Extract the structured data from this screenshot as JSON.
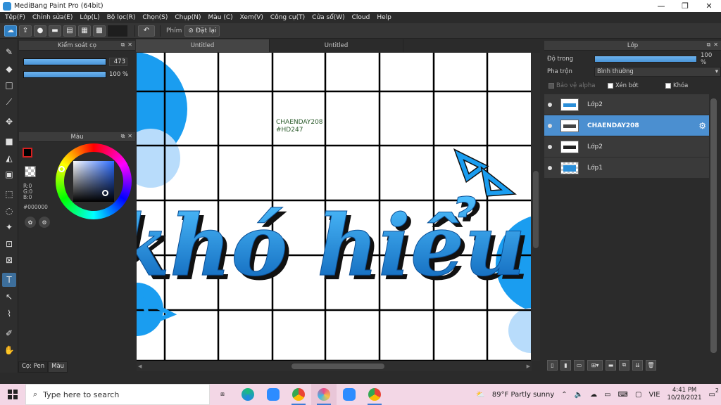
{
  "window": {
    "title": "MediBang Paint Pro (64bit)",
    "minimize_glyph": "—",
    "maximize_glyph": "❐",
    "close_glyph": "✕"
  },
  "menu": [
    "Tệp(F)",
    "Chỉnh sửa(E)",
    "Lớp(L)",
    "Bộ lọc(R)",
    "Chọn(S)",
    "Chụp(N)",
    "Màu (C)",
    "Xem(V)",
    "Công cụ(T)",
    "Cửa sổ(W)",
    "Cloud",
    "Help"
  ],
  "toolbar": {
    "shortcut_label": "Phím",
    "reset_label": "Đặt lại"
  },
  "brush_panel": {
    "title": "Kiểm soát cọ",
    "size_value": "473",
    "size_fraction": 1.0,
    "opacity_value": "100 %",
    "opacity_fraction": 1.0
  },
  "color_panel": {
    "title": "Màu",
    "r_label": "R:0",
    "g_label": "G:0",
    "b_label": "B:0",
    "hex": "#000000",
    "foreground": "#000000",
    "background": "#ffffff"
  },
  "bottom_tabs": [
    "Cọ: Pen",
    "Màu"
  ],
  "documents": [
    {
      "label": "Untitled",
      "active": true
    },
    {
      "label": "Untitled",
      "active": false
    }
  ],
  "canvas": {
    "watermark_line1": "CHAENDAY208",
    "watermark_line2": "#HD247",
    "artwork_text": "khó hiểu",
    "accent": "#1e90e0",
    "grid_color": "#000000"
  },
  "layer_panel": {
    "title": "Lớp",
    "opacity_label": "Độ trong",
    "opacity_value": "100 %",
    "blend_label": "Pha trộn",
    "blend_value": "Bình thường",
    "protect_alpha_label": "Bảo vệ alpha",
    "clipping_label": "Xén bớt",
    "lock_label": "Khóa",
    "layers": [
      {
        "name": "Lớp2",
        "selected": false
      },
      {
        "name": "CHAENDAY208",
        "selected": true
      },
      {
        "name": "Lớp2",
        "selected": false
      },
      {
        "name": "Lớp1",
        "selected": false
      }
    ]
  },
  "taskbar": {
    "search_placeholder": "Type here to search",
    "weather": "89°F  Partly sunny",
    "language": "VIE",
    "time": "4:41 PM",
    "date": "10/28/2021",
    "notification_count": "2"
  }
}
